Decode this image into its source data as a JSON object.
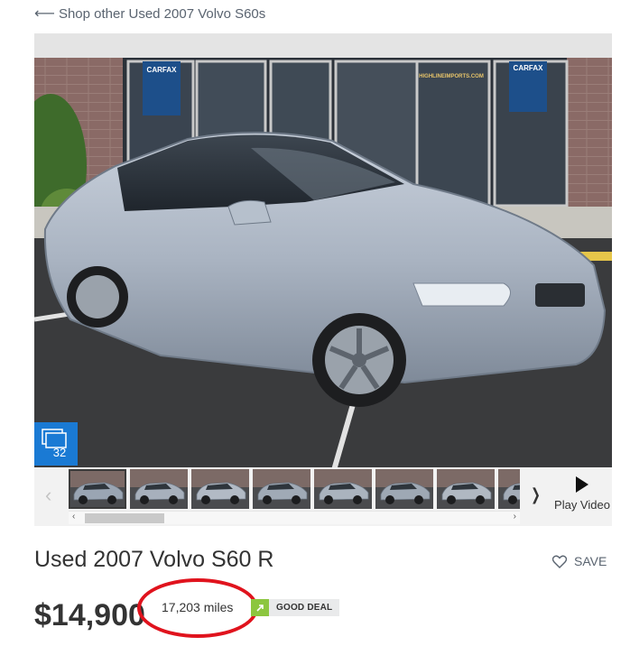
{
  "nav": {
    "back_link": "Shop other Used 2007 Volvo S60s"
  },
  "gallery": {
    "photo_count": "32",
    "storefront_sign_1": "CARFAX",
    "storefront_sign_2": "CARFAX",
    "storefront_website": "HIGHLINEIMPORTS.COM",
    "thumbnail_count": 8,
    "selected_thumbnail": 1
  },
  "video": {
    "label": "Play Video"
  },
  "listing": {
    "title": "Used 2007 Volvo S60 R",
    "save_label": "SAVE",
    "price": "$14,900",
    "mileage": "17,203 miles",
    "deal_rating": "GOOD DEAL"
  },
  "colors": {
    "accent_blue": "#1a7ad4",
    "deal_green": "#8cc63f",
    "highlight_red": "#e0131d"
  }
}
